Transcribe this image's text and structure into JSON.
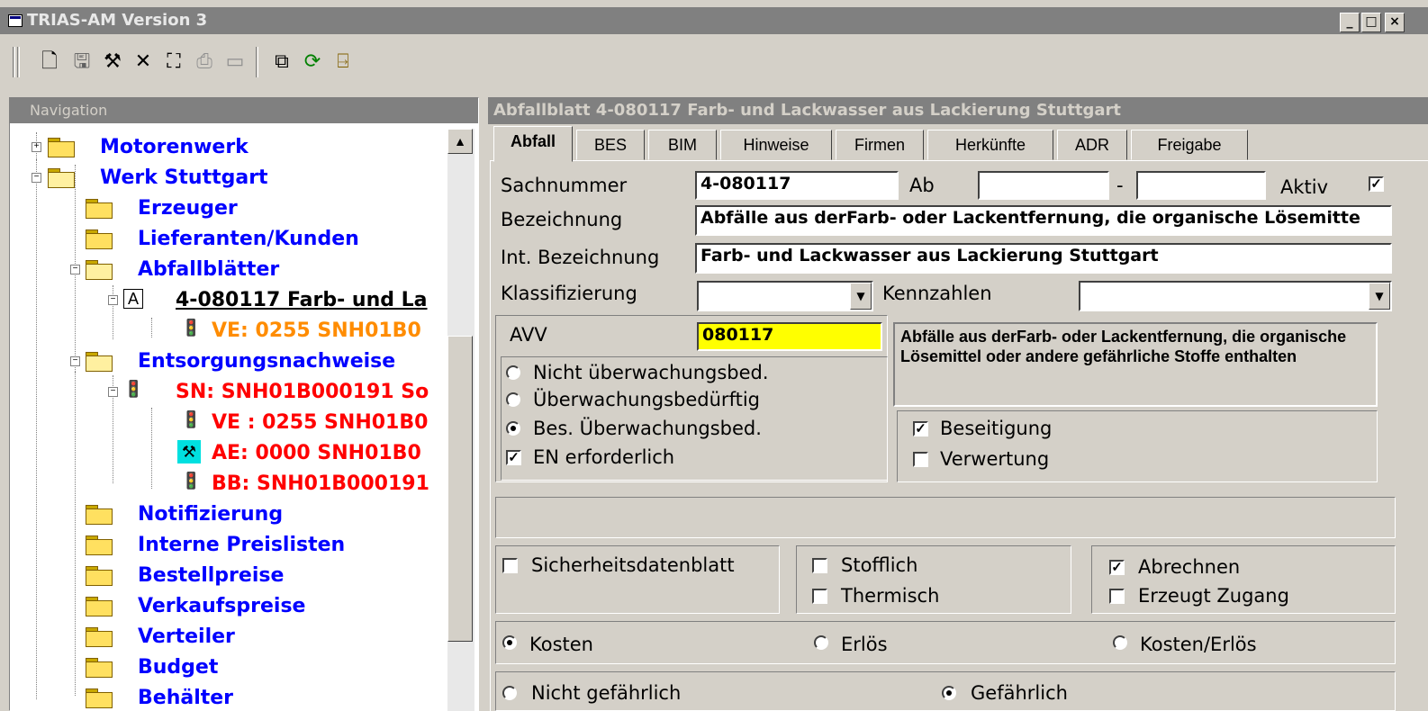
{
  "window": {
    "title": "TRIAS-AM Version 3",
    "caption_buttons": [
      "_",
      "□",
      "×"
    ]
  },
  "toolbar": {
    "icons": [
      "new-icon",
      "save-icon",
      "tools-icon",
      "delete-icon",
      "find-icon",
      "print-icon",
      "monitor-icon",
      "copy-icon",
      "refresh-icon",
      "exit-icon"
    ]
  },
  "navigation": {
    "header": "Navigation",
    "items": [
      {
        "label": "Motorenwerk"
      },
      {
        "label": "Werk Stuttgart"
      },
      {
        "label": "Erzeuger"
      },
      {
        "label": "Lieferanten/Kunden"
      },
      {
        "label": "Abfallblätter"
      },
      {
        "label": "4-080117 Farb- und La",
        "badge": "A"
      },
      {
        "label": "VE: 0255 SNH01B0"
      },
      {
        "label": "Entsorgungsnachweise"
      },
      {
        "label": "SN: SNH01B000191 So"
      },
      {
        "label": "VE : 0255 SNH01B0"
      },
      {
        "label": "AE: 0000 SNH01B0"
      },
      {
        "label": "BB: SNH01B000191"
      },
      {
        "label": "Notifizierung"
      },
      {
        "label": "Interne Preislisten"
      },
      {
        "label": "Bestellpreise"
      },
      {
        "label": "Verkaufspreise"
      },
      {
        "label": "Verteiler"
      },
      {
        "label": "Budget"
      },
      {
        "label": "Behälter"
      }
    ]
  },
  "detail": {
    "header": "Abfallblatt 4-080117 Farb- und Lackwasser aus Lackierung Stuttgart",
    "tabs": [
      "Abfall",
      "BES",
      "BIM",
      "Hinweise",
      "Firmen",
      "Herkünfte",
      "ADR",
      "Freigabe"
    ],
    "sachnummer_label": "Sachnummer",
    "sachnummer_value": "4-080117",
    "ab_label": "Ab",
    "ab_value": "",
    "dash": "-",
    "bis_value": "",
    "aktiv_label": "Aktiv",
    "aktiv_checked": "✓",
    "bezeichnung_label": "Bezeichnung",
    "bezeichnung_value": "Abfälle aus derFarb- oder Lackentfernung,  die organische Lösemitte",
    "int_bezeichnung_label": "Int. Bezeichnung",
    "int_bezeichnung_value": "Farb- und Lackwasser aus Lackierung Stuttgart",
    "klassifizierung_label": "Klassifizierung",
    "klassifizierung_value": "",
    "kennzahlen_label": "Kennzahlen",
    "kennzahlen_value": "",
    "avv_label": "AVV",
    "avv_value": "080117",
    "avv_highlight": "#ffff00",
    "avv_description": "Abfälle aus derFarb- oder Lackentfernung,  die organische Lösemittel oder andere gefährliche Stoffe enthalten",
    "monitoring_options": [
      "Nicht überwachungsbed.",
      "Überwachungsbedürftig",
      "Bes. Überwachungsbed."
    ],
    "monitoring_selected": "Bes. Überwachungsbed.",
    "en_label": "EN erforderlich",
    "en_checked": "✓",
    "beseitigung_label": "Beseitigung",
    "beseitigung_checked": "✓",
    "verwertung_label": "Verwertung",
    "verwertung_checked": "",
    "sdb_label": "Sicherheitsdatenblatt",
    "sdb_checked": "",
    "stofflich_label": "Stofflich",
    "stofflich_checked": "",
    "thermisch_label": "Thermisch",
    "thermisch_checked": "",
    "abrechnen_label": "Abrechnen",
    "abrechnen_checked": "✓",
    "erzeugt_label": "Erzeugt Zugang",
    "erzeugt_checked": "",
    "cost_options": [
      "Kosten",
      "Erlös",
      "Kosten/Erlös"
    ],
    "cost_selected": "Kosten",
    "danger_options": [
      "Nicht gefährlich",
      "Gefährlich"
    ],
    "danger_selected": "Gefährlich"
  }
}
